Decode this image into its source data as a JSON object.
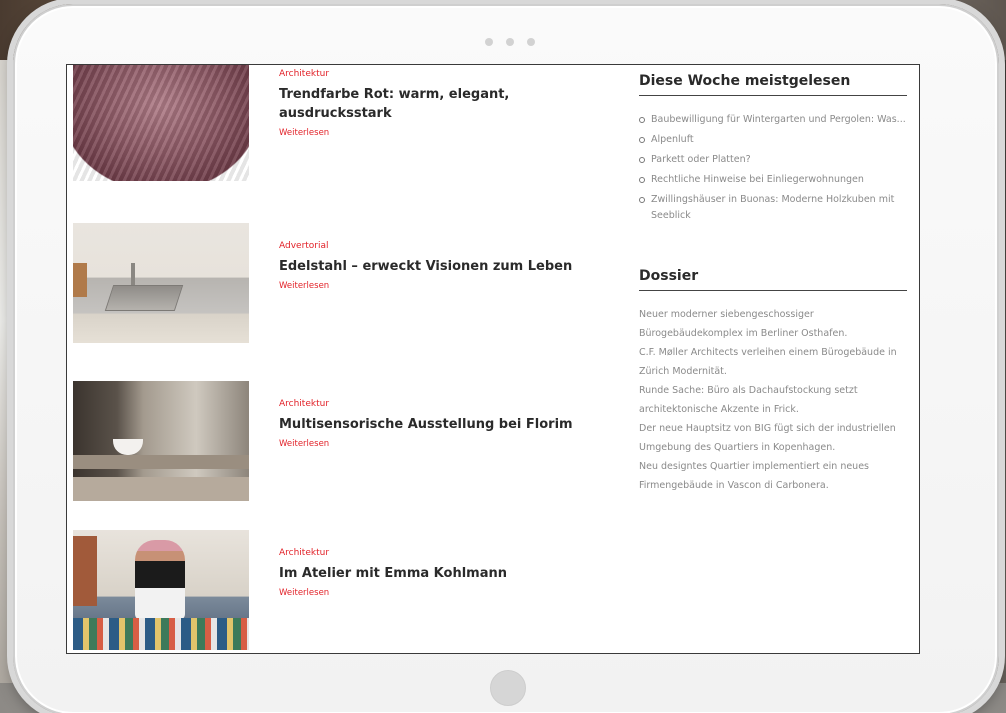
{
  "articles": [
    {
      "category": "Architektur",
      "title": "Trendfarbe Rot: warm, elegant, ausdrucksstark",
      "read_more": "Weiterlesen",
      "image": "red-hair-thumbnail"
    },
    {
      "category": "Advertorial",
      "title": "Edelstahl – erweckt Visionen zum Leben",
      "read_more": "Weiterlesen",
      "image": "stainless-sink-thumbnail"
    },
    {
      "category": "Architektur",
      "title": "Multisensorische Ausstellung bei Florim",
      "read_more": "Weiterlesen",
      "image": "bathroom-thumbnail"
    },
    {
      "category": "Architektur",
      "title": "Im Atelier mit Emma Kohlmann",
      "read_more": "Weiterlesen",
      "image": "atelier-thumbnail"
    }
  ],
  "sidebar": {
    "popular_heading": "Diese Woche meistgelesen",
    "popular": [
      "Baubewilligung für Wintergarten und Pergolen: Was...",
      "Alpenluft",
      "Parkett oder Platten?",
      "Rechtliche Hinweise bei Einliegerwohnungen",
      "Zwillingshäuser in Buonas: Moderne Holzkuben mit Seeblick"
    ],
    "dossier_heading": "Dossier",
    "dossier": [
      "Neuer moderner siebengeschossiger Bürogebäudekomplex im Berliner Osthafen.",
      "C.F. Møller Architects verleihen einem Bürogebäude in Zürich Modernität.",
      "Runde Sache: Büro als Dachaufstockung setzt architektonische Akzente in Frick.",
      "Der neue Hauptsitz von BIG fügt sich der industriellen Umgebung des Quartiers in Kopenhagen.",
      "Neu designtes Quartier implementiert ein neues Firmengebäude in Vascon di Carbonera."
    ]
  },
  "colors": {
    "accent": "#e2232a",
    "text": "#2a2a2a",
    "muted": "#8a8a8a"
  }
}
